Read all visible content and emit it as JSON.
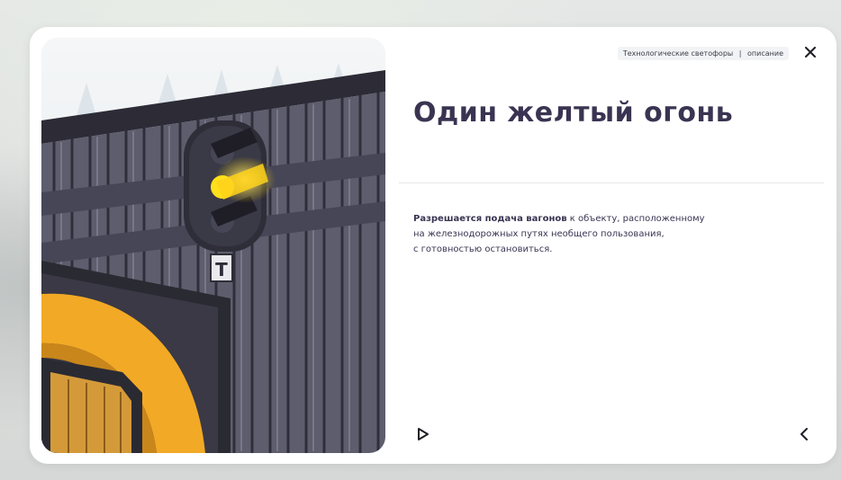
{
  "breadcrumb": {
    "section": "Технологические светофоры",
    "separator": "|",
    "page": "описание"
  },
  "icons": {
    "close": "close-icon",
    "play": "play-icon",
    "back": "arrow-left-icon"
  },
  "signal": {
    "plate_letter": "Т",
    "active_light": "yellow"
  },
  "content": {
    "title": "Один желтый огонь",
    "desc_bold": "Разрешается подача вагонов",
    "desc_rest": " к объекту, расположенному",
    "desc_line2": "на железнодорожных путях необщего пользования,",
    "desc_line3": "с готовностью остановиться."
  },
  "colors": {
    "title": "#3a3452",
    "signal_yellow": "#ffe01a",
    "door_orange": "#f2a925",
    "wall": "#5b5a6a"
  }
}
